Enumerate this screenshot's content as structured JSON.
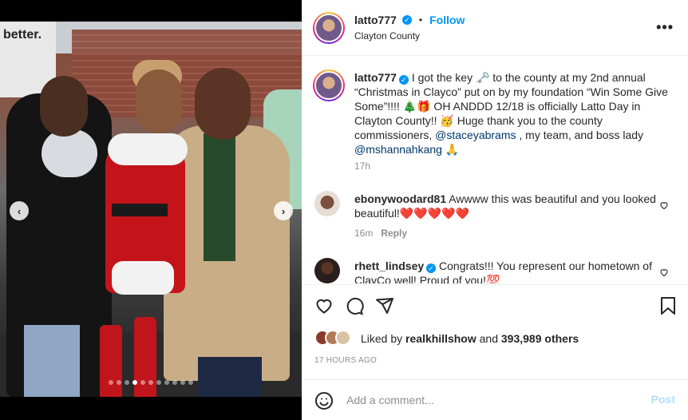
{
  "post": {
    "author": "latto777",
    "follow_label": "Follow",
    "separator": "•",
    "location": "Clayton County",
    "more_label": "•••",
    "caption": {
      "username": "latto777",
      "text_1": "I got the key 🗝️ to the county at my 2nd annual “Christmas in Clayco” put on by my foundation “Win Some Give Some”!!!! 🎄🎁 OH ANDDD 12/18 is officially Latto Day in Clayton County!! 🥳 Huge thank you to the county commissioners, ",
      "mention_1": "@staceyabrams",
      "text_2": " , my team, and boss lady ",
      "mention_2": "@mshannahkang",
      "text_3": " 🙏",
      "time": "17h"
    },
    "comments": [
      {
        "username": "ebonywoodard81",
        "text": "Awwww this was beautiful and you looked beautiful!❤️❤️❤️❤️❤️",
        "time": "16m",
        "reply_label": "Reply"
      },
      {
        "username": "rhett_lindsey",
        "text": "Congrats!!! You represent our hometown of ClayCo well! Proud of you!💯",
        "time": "",
        "reply_label": ""
      }
    ],
    "likes": {
      "prefix": "Liked by ",
      "liker": "realkhillshow",
      "middle": " and ",
      "others": "393,989 others"
    },
    "timestamp": "17 HOURS AGO",
    "add_comment": {
      "placeholder": "Add a comment...",
      "post_label": "Post"
    }
  },
  "media": {
    "truck_text": "better.",
    "prev_label": "‹",
    "next_label": "›",
    "slide_count": 11,
    "active_slide": 4
  },
  "colors": {
    "accent": "#0095f6",
    "mention": "#00376b",
    "muted": "#8e8e8e",
    "post_disabled": "#b2dffc"
  }
}
